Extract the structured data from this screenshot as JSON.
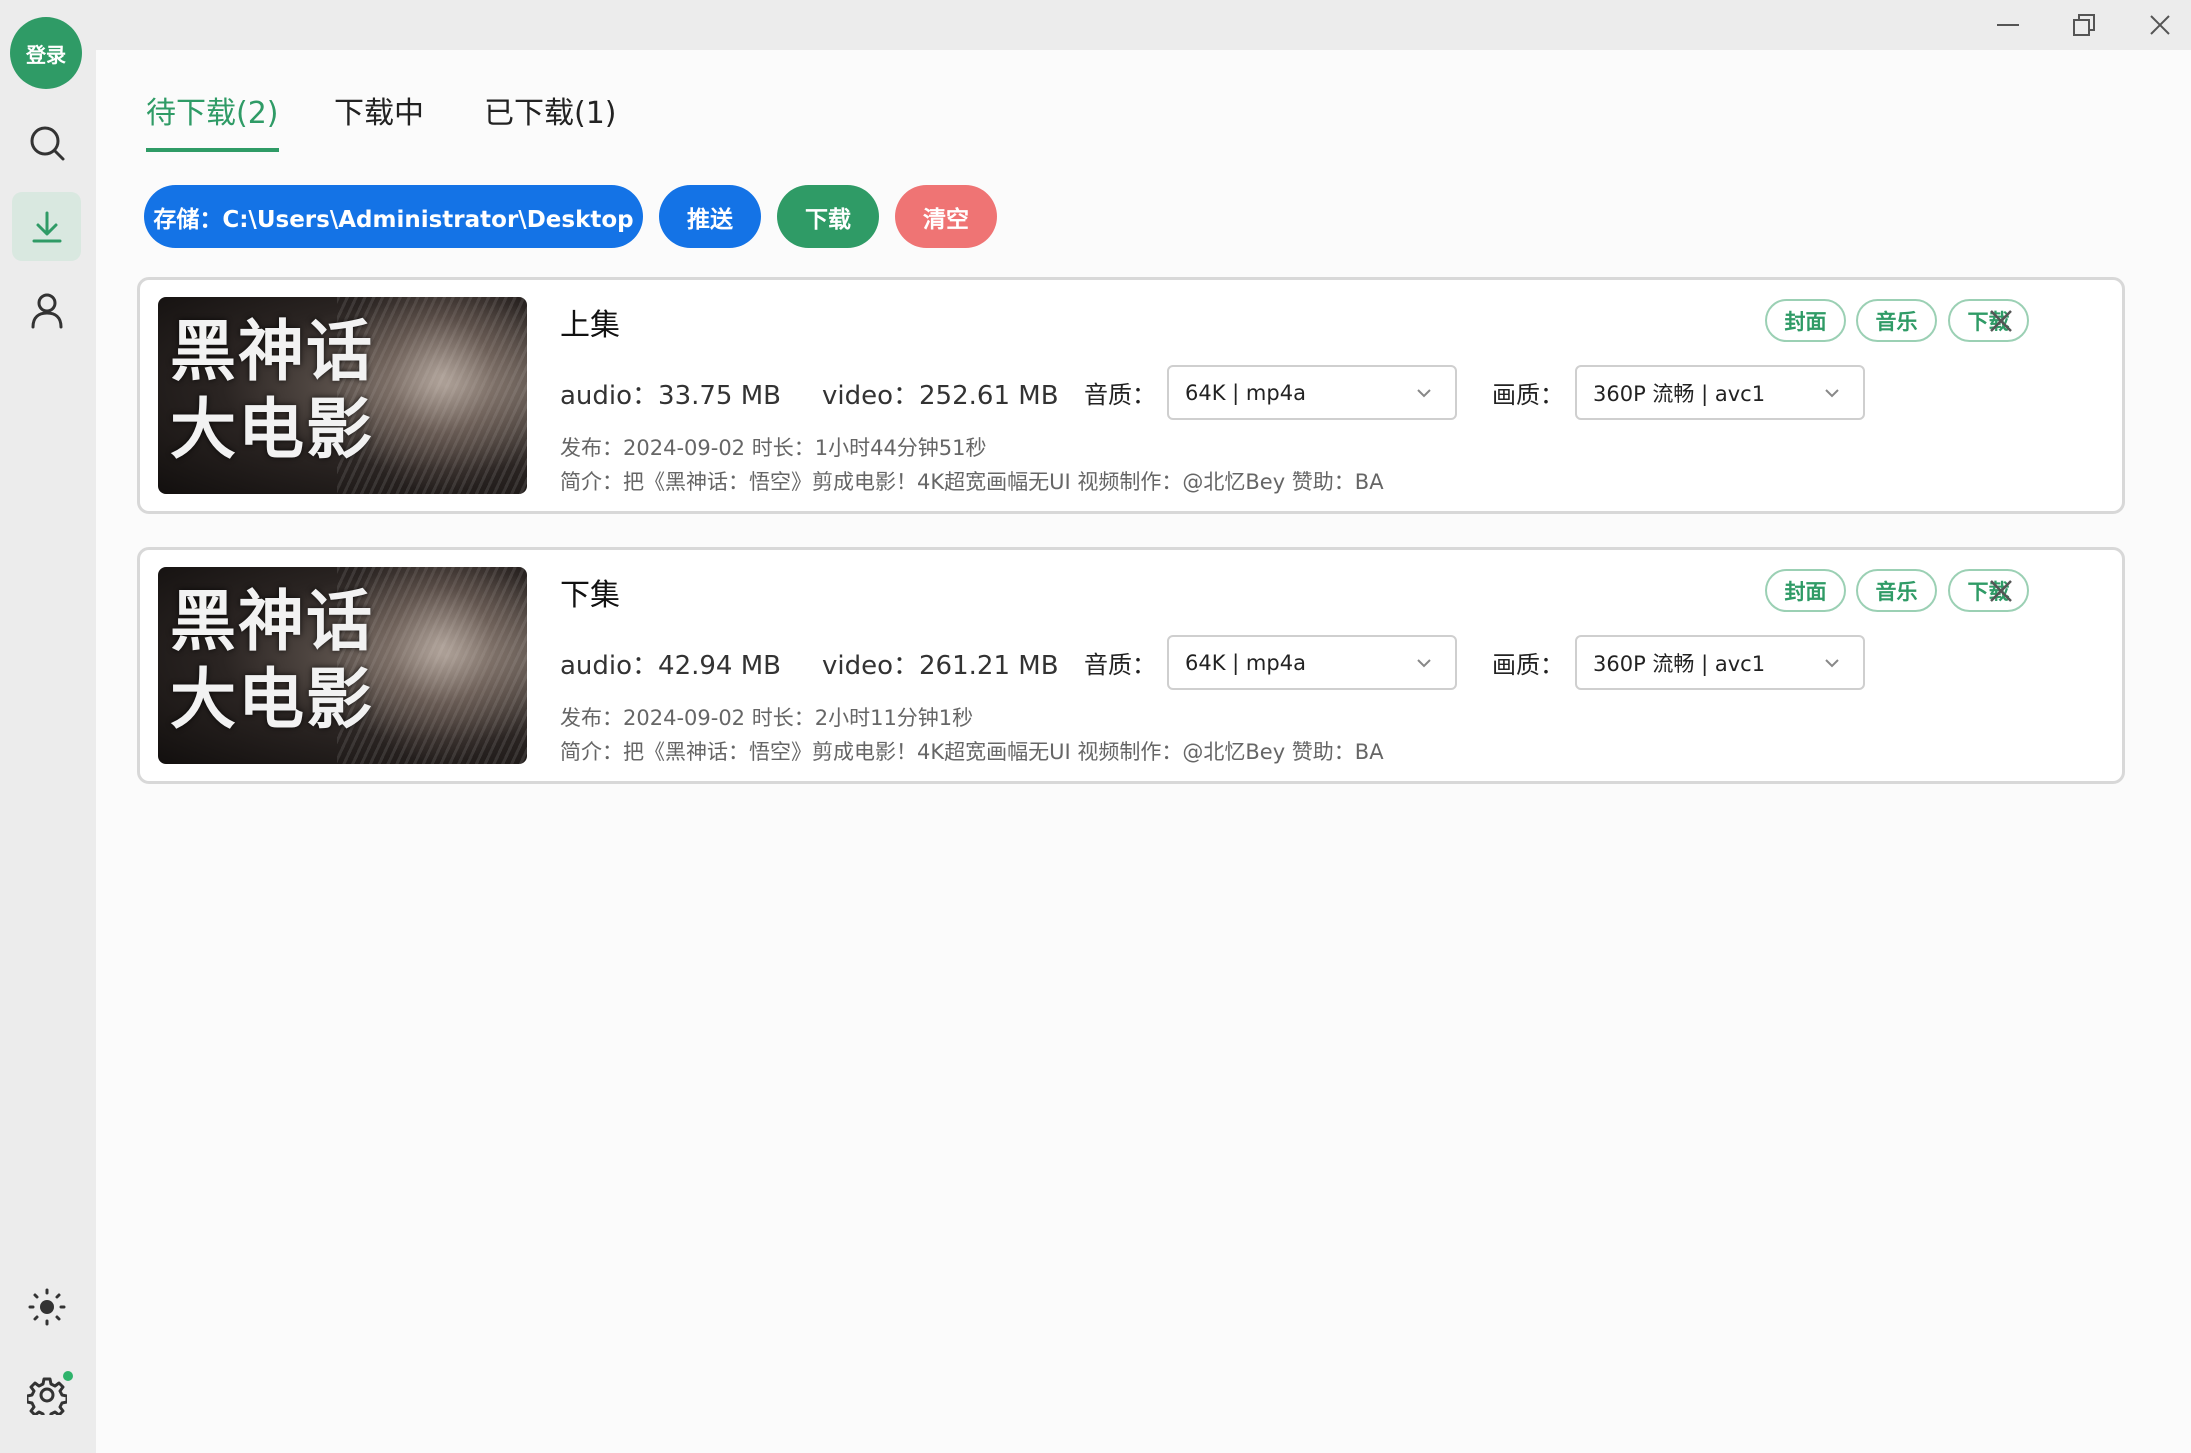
{
  "sidebar": {
    "login_label": "登录",
    "nav": [
      "search-icon",
      "download-icon",
      "user-icon"
    ],
    "bottom": [
      "brightness-icon",
      "settings-icon"
    ]
  },
  "window_controls": [
    "minimize-icon",
    "restore-icon",
    "close-icon"
  ],
  "tabs": [
    {
      "label": "待下载(2)",
      "active": true
    },
    {
      "label": "下载中",
      "active": false
    },
    {
      "label": "已下载(1)",
      "active": false
    }
  ],
  "toolbar": {
    "storage_label": "存储：C:\\Users\\Administrator\\Desktop",
    "push_label": "推送",
    "download_label": "下载",
    "clear_label": "清空"
  },
  "colors": {
    "accent": "#2f9b66",
    "blue": "#1473e6",
    "red": "#ef7474"
  },
  "items": [
    {
      "thumb_line1": "黑神话",
      "thumb_line2": "大电影",
      "title": "上集",
      "audio": "audio：33.75 MB",
      "video": "video：252.61 MB",
      "audio_quality_label": "音质：",
      "audio_quality": "64K | mp4a",
      "video_quality_label": "画质：",
      "video_quality": "360P 流畅 | avc1",
      "publish": "发布：2024-09-02 时长：1小时44分钟51秒",
      "intro": "简介：把《黑神话：悟空》剪成电影！4K超宽画幅无UI 视频制作：@北忆Bey 赞助：BA",
      "tags": [
        "封面",
        "音乐",
        "下载"
      ]
    },
    {
      "thumb_line1": "黑神话",
      "thumb_line2": "大电影",
      "title": "下集",
      "audio": "audio：42.94 MB",
      "video": "video：261.21 MB",
      "audio_quality_label": "音质：",
      "audio_quality": "64K | mp4a",
      "video_quality_label": "画质：",
      "video_quality": "360P 流畅 | avc1",
      "publish": "发布：2024-09-02 时长：2小时11分钟1秒",
      "intro": "简介：把《黑神话：悟空》剪成电影！4K超宽画幅无UI 视频制作：@北忆Bey 赞助：BA",
      "tags": [
        "封面",
        "音乐",
        "下载"
      ]
    }
  ]
}
